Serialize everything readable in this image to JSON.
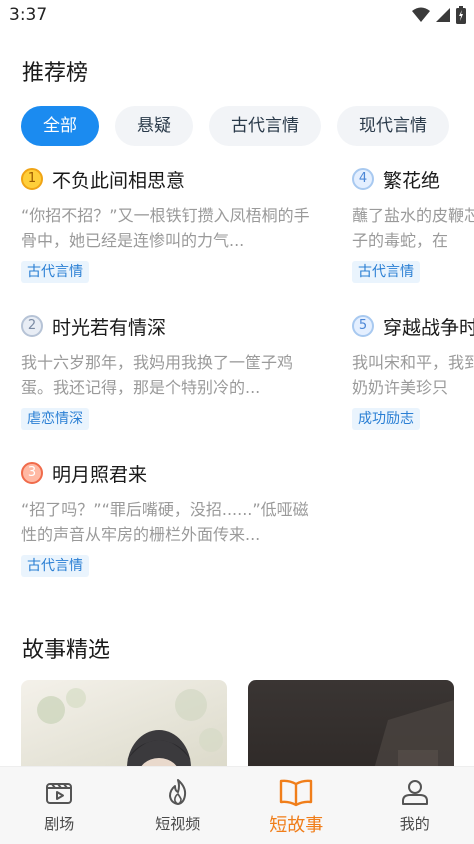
{
  "status": {
    "time": "3:37"
  },
  "rankings": {
    "title": "推荐榜",
    "tabs": [
      {
        "label": "全部",
        "active": true
      },
      {
        "label": "悬疑"
      },
      {
        "label": "古代言情"
      },
      {
        "label": "现代言情"
      }
    ],
    "items": [
      {
        "rank": "1",
        "title": "不负此间相思意",
        "desc": "“你招不招？”又一根铁钉攒入凤梧桐的手骨中，她已经是连惨叫的力气...",
        "tag": "古代言情"
      },
      {
        "rank": "2",
        "title": "时光若有情深",
        "desc": "我十六岁那年，我妈用我换了一筐子鸡蛋。我还记得，那是个特别冷的...",
        "tag": "虐恋情深"
      },
      {
        "rank": "3",
        "title": "明月照君来",
        "desc": "“招了吗？”“罪后嘴硬，没招......”低哑磁性的声音从牢房的栅栏外面传来...",
        "tag": "古代言情"
      },
      {
        "rank": "4",
        "title": "繁花绝",
        "desc": "蘸了盐水的皮鞭芯子的毒蛇，在",
        "tag": "古代言情"
      },
      {
        "rank": "5",
        "title": "穿越战争时",
        "desc": "我叫宋和平，我到奶奶许美珍只",
        "tag": "成功励志"
      }
    ]
  },
  "featured": {
    "title": "故事精选"
  },
  "bottom_nav": [
    {
      "label": "剧场",
      "icon": "theater-icon"
    },
    {
      "label": "短视频",
      "icon": "flame-icon"
    },
    {
      "label": "短故事",
      "icon": "book-icon",
      "active": true
    },
    {
      "label": "我的",
      "icon": "user-icon"
    }
  ],
  "colors": {
    "accent": "#1b8bf0",
    "nav_active": "#f07e1a",
    "tag_text": "#2a7fd4"
  }
}
